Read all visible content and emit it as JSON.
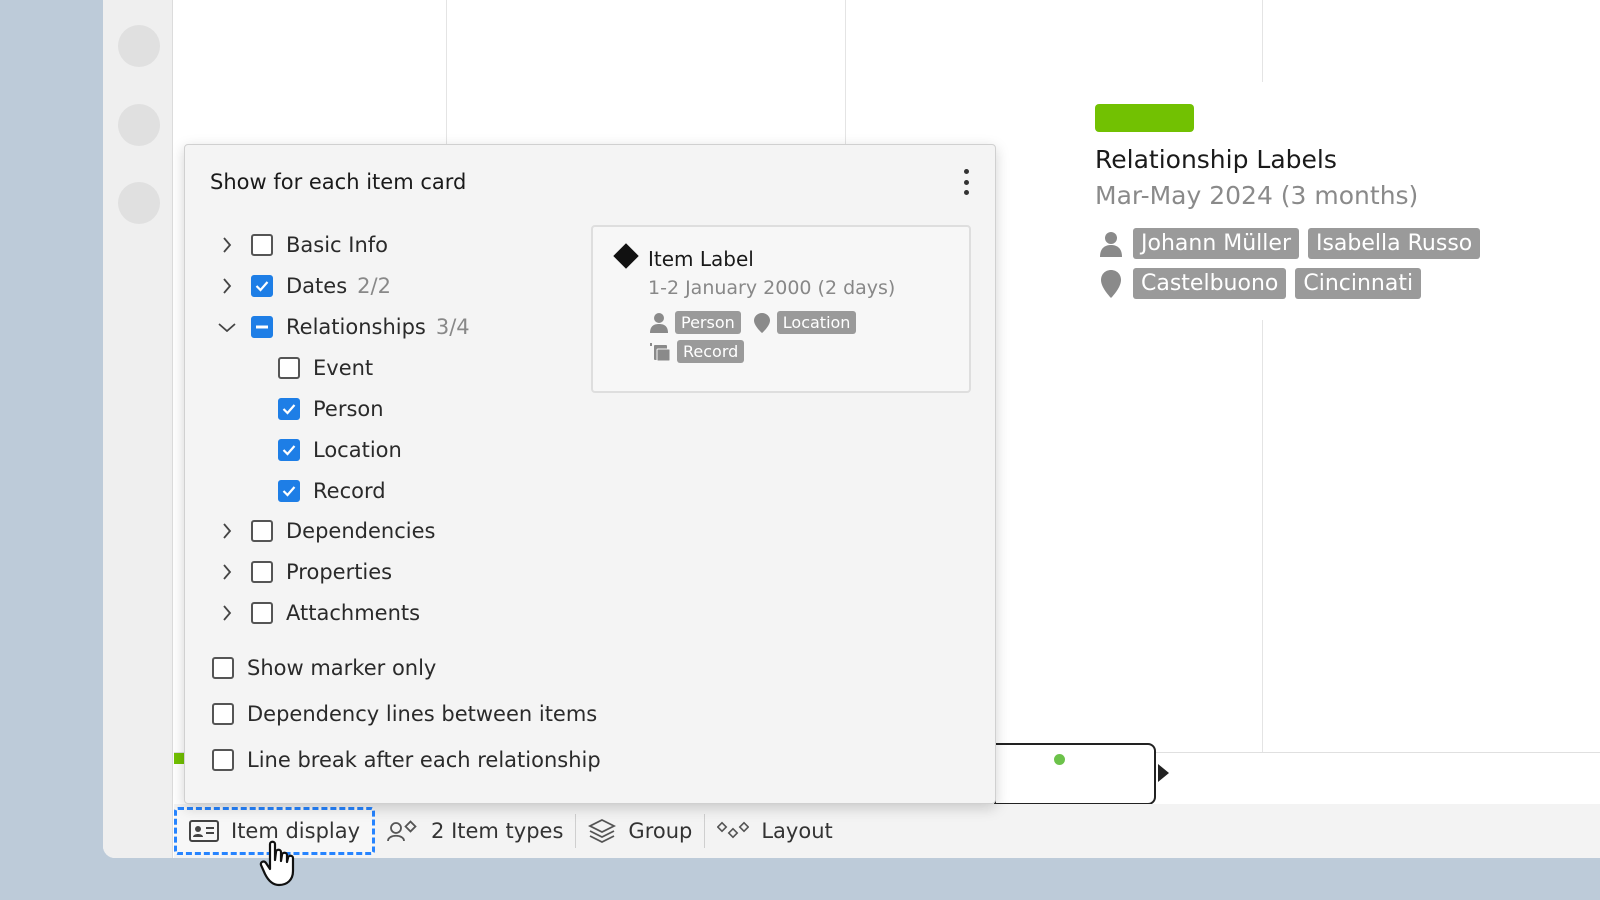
{
  "timeline_card": {
    "title": "Relationship Labels",
    "dates": "Mar-May 2024 (3 months)",
    "people": [
      "Johann Müller",
      "Isabella Russo"
    ],
    "locations": [
      "Castelbuono",
      "Cincinnati"
    ],
    "bar_color": "#72c102"
  },
  "popover": {
    "title": "Show for each item card",
    "tree": [
      {
        "label": "Basic Info",
        "count": "",
        "state": "unchecked",
        "expanded": false
      },
      {
        "label": "Dates",
        "count": "2/2",
        "state": "checked",
        "expanded": false
      },
      {
        "label": "Relationships",
        "count": "3/4",
        "state": "partial",
        "expanded": true,
        "children": [
          {
            "label": "Event",
            "state": "unchecked"
          },
          {
            "label": "Person",
            "state": "checked"
          },
          {
            "label": "Location",
            "state": "checked"
          },
          {
            "label": "Record",
            "state": "checked"
          }
        ]
      },
      {
        "label": "Dependencies",
        "count": "",
        "state": "unchecked",
        "expanded": false
      },
      {
        "label": "Properties",
        "count": "",
        "state": "unchecked",
        "expanded": false
      },
      {
        "label": "Attachments",
        "count": "",
        "state": "unchecked",
        "expanded": false
      }
    ],
    "options": [
      {
        "label": "Show marker only",
        "state": "unchecked"
      },
      {
        "label": "Dependency lines between items",
        "state": "unchecked"
      },
      {
        "label": "Line break after each relationship",
        "state": "unchecked"
      }
    ],
    "preview": {
      "title": "Item Label",
      "dates": "1-2 January 2000 (2 days)",
      "chips": [
        "Person",
        "Location",
        "Record"
      ]
    }
  },
  "toolbar": {
    "item_display": "Item display",
    "item_types": "2 Item types",
    "group": "Group",
    "layout": "Layout"
  },
  "colors": {
    "accent_blue": "#1e7ee6",
    "chip_gray": "#9a9a9a",
    "green": "#72c102"
  }
}
